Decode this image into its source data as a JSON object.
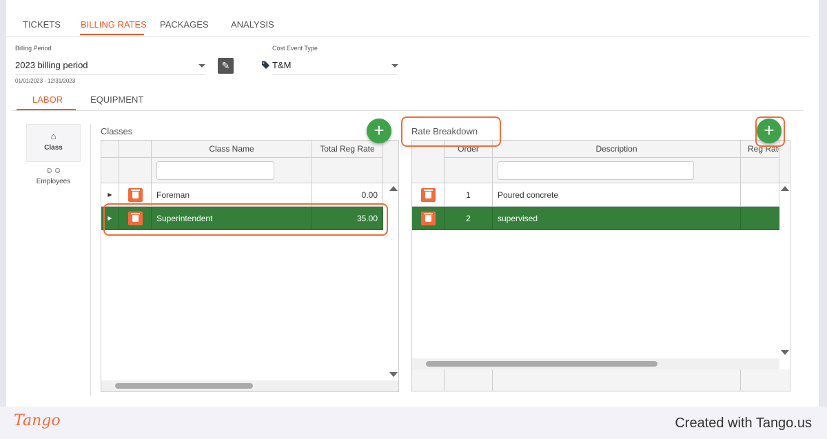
{
  "tabs": [
    {
      "label": "TICKETS"
    },
    {
      "label": "BILLING RATES",
      "active": true
    },
    {
      "label": "PACKAGES"
    },
    {
      "label": "ANALYSIS"
    }
  ],
  "billing_period": {
    "label": "Billing Period",
    "value": "2023 billing period",
    "range": "01/01/2023 - 12/31/2023"
  },
  "cost_event_type": {
    "label": "Cost Event Type",
    "value": "T&M",
    "icon": "tag-icon"
  },
  "subtabs": [
    {
      "label": "LABOR",
      "active": true
    },
    {
      "label": "EQUIPMENT"
    }
  ],
  "side": [
    {
      "label": "Class",
      "icon": "graduation-cap-icon",
      "active": true
    },
    {
      "label": "Employees",
      "icon": "users-icon"
    }
  ],
  "classes": {
    "title": "Classes",
    "columns": [
      "",
      "",
      "Class Name",
      "Total Reg Rate"
    ],
    "rows": [
      {
        "name": "Foreman",
        "rate": "0.00"
      },
      {
        "name": "Superintendent",
        "rate": "35.00",
        "selected": true
      }
    ]
  },
  "rate_breakdown": {
    "title": "Rate Breakdown",
    "columns": [
      "",
      "Order",
      "Description",
      "Reg Rate"
    ],
    "rows": [
      {
        "order": "1",
        "description": "Poured concrete"
      },
      {
        "order": "2",
        "description": "supervised",
        "selected": true
      }
    ]
  },
  "colors": {
    "accent": "#f05a28",
    "selected_row": "#357f3a",
    "add_button": "#3fa24a",
    "highlight": "#f26b3a"
  },
  "footer": {
    "logo": "Tango",
    "text": "Created with Tango.us"
  }
}
